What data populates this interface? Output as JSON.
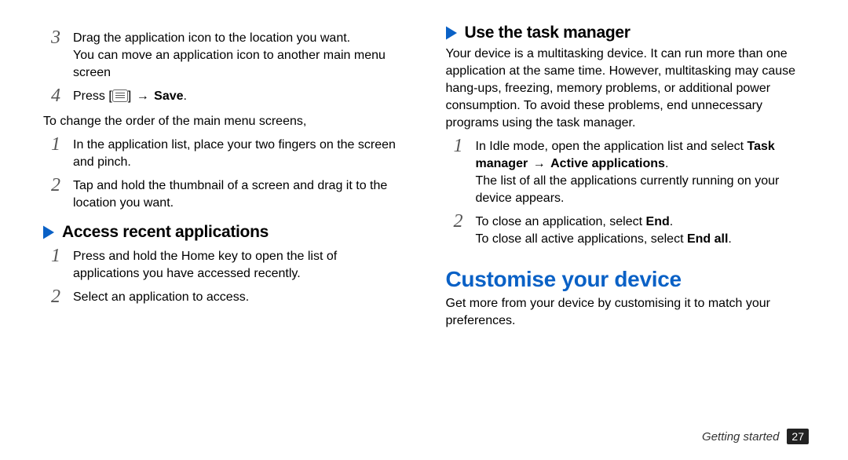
{
  "left": {
    "step3_a": "Drag the application icon to the location you want.",
    "step3_b": "You can move an application icon to another main menu screen",
    "step4_prefix": "Press [",
    "step4_mid": "] ",
    "step4_arrow": "→",
    "step4_save": "Save",
    "step4_end": ".",
    "body1": "To change the order of the main menu screens,",
    "step1": "In the application list, place your two fingers on the screen and pinch.",
    "step2": "Tap and hold the thumbnail of a screen and drag it to the location you want.",
    "h2a": "Access recent applications",
    "a_step1": "Press and hold the Home key to open the list of applications you have accessed recently.",
    "a_step2": "Select an application to access."
  },
  "right": {
    "h2b": "Use the task manager",
    "intro": "Your device is a multitasking device. It can run more than one application at the same time. However, multitasking may cause hang-ups, freezing, memory problems, or additional power consumption. To avoid these problems, end unnecessary programs using the task manager.",
    "b_step1_pre": "In Idle mode, open the application list and select ",
    "b_step1_bold1": "Task manager",
    "b_step1_arrow": "→",
    "b_step1_bold2": "Active applications",
    "b_step1_end": ".",
    "b_step1_after": "The list of all the applications currently running on your device appears.",
    "b_step2_pre": "To close an application, select ",
    "b_step2_bold": "End",
    "b_step2_end": ".",
    "b_step2_after_pre": "To close all active applications, select ",
    "b_step2_after_bold": "End all",
    "b_step2_after_end": ".",
    "h1": "Customise your device",
    "h1_body": "Get more from your device by customising it to match your preferences."
  },
  "footer": {
    "chapter": "Getting started",
    "page": "27"
  },
  "nums": {
    "n1": "1",
    "n2": "2",
    "n3": "3",
    "n4": "4"
  }
}
